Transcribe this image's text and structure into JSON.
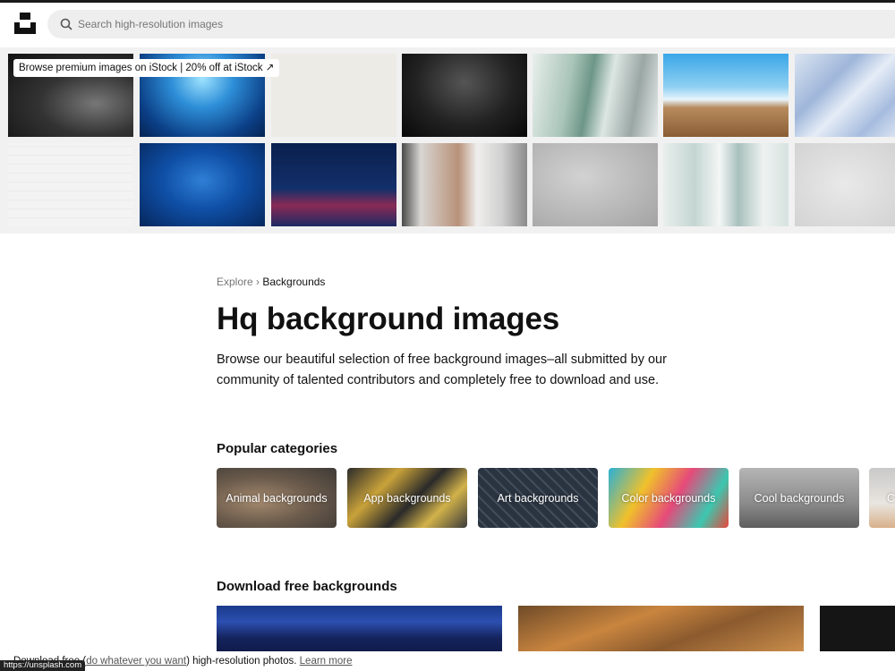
{
  "header": {
    "search_placeholder": "Search high-resolution images",
    "logo_icon": "unsplash-logo-icon",
    "search_icon": "search-icon"
  },
  "istock_banner": "Browse premium images on iStock | 20% off at iStock ↗",
  "breadcrumb": {
    "root": "Explore",
    "separator": "›",
    "current": "Backgrounds"
  },
  "page_title": "Hq background images",
  "description": "Browse our beautiful selection of free background images–all submitted by our community of talented contributors and completely free to download and use.",
  "popular_categories": {
    "heading": "Popular categories",
    "items": [
      {
        "label": "Animal backgrounds"
      },
      {
        "label": "App backgrounds"
      },
      {
        "label": "Art backgrounds"
      },
      {
        "label": "Color backgrounds"
      },
      {
        "label": "Cool backgrounds"
      },
      {
        "label": "C"
      }
    ]
  },
  "download_section": {
    "heading": "Download free backgrounds"
  },
  "cookie_bar": {
    "text_before": "Download free (",
    "link_text": "do whatever you want",
    "text_after": ") high-resolution photos.",
    "learn_more": "Learn more"
  },
  "status_url": "https://unsplash.com"
}
